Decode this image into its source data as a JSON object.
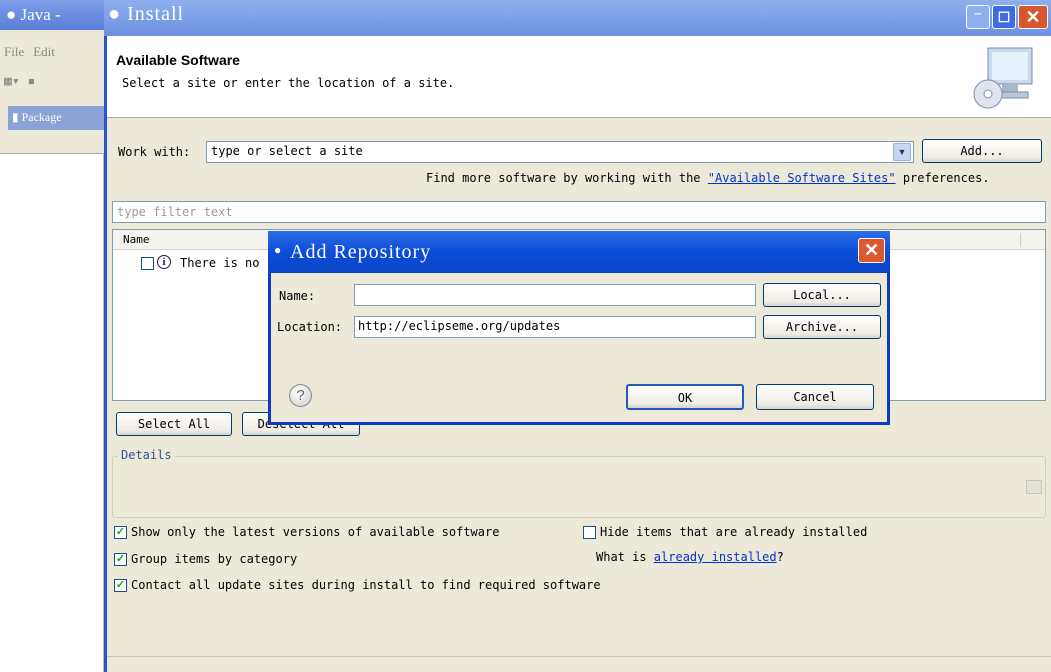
{
  "background_window": {
    "title": "Java -",
    "menu": [
      "File",
      "Edit"
    ],
    "view_tab": "Package"
  },
  "install": {
    "title": "Install",
    "header": {
      "title": "Available Software",
      "subtitle": "Select a site or enter the location of a site."
    },
    "work_with": {
      "label": "Work with:",
      "value": "type or select a site",
      "add_button": "Add..."
    },
    "find_more": {
      "prefix": "Find more software by working with the ",
      "link": "\"Available Software Sites\"",
      "suffix": " preferences."
    },
    "filter": {
      "placeholder": "type filter text"
    },
    "table": {
      "column": "Name",
      "row_text": "There is no"
    },
    "select_all": "Select All",
    "deselect_all": "Deselect All",
    "details": {
      "label": "Details"
    },
    "options": {
      "show_latest": {
        "label": "Show only the latest versions of available software",
        "checked": true
      },
      "hide_installed": {
        "label": "Hide items that are already installed",
        "checked": false
      },
      "group_by_category": {
        "label": "Group items by category",
        "checked": true
      },
      "what_installed_prefix": "What is ",
      "what_installed_link": "already installed",
      "what_installed_suffix": "?",
      "contact_sites": {
        "label": "Contact all update sites during install to find required software",
        "checked": true
      }
    }
  },
  "add_repository": {
    "title": "Add Repository",
    "name_label": "Name:",
    "name_value": "",
    "location_label": "Location:",
    "location_value": "http://eclipseme.org/updates",
    "local_button": "Local...",
    "archive_button": "Archive...",
    "ok_button": "OK",
    "cancel_button": "Cancel",
    "help_glyph": "?"
  }
}
